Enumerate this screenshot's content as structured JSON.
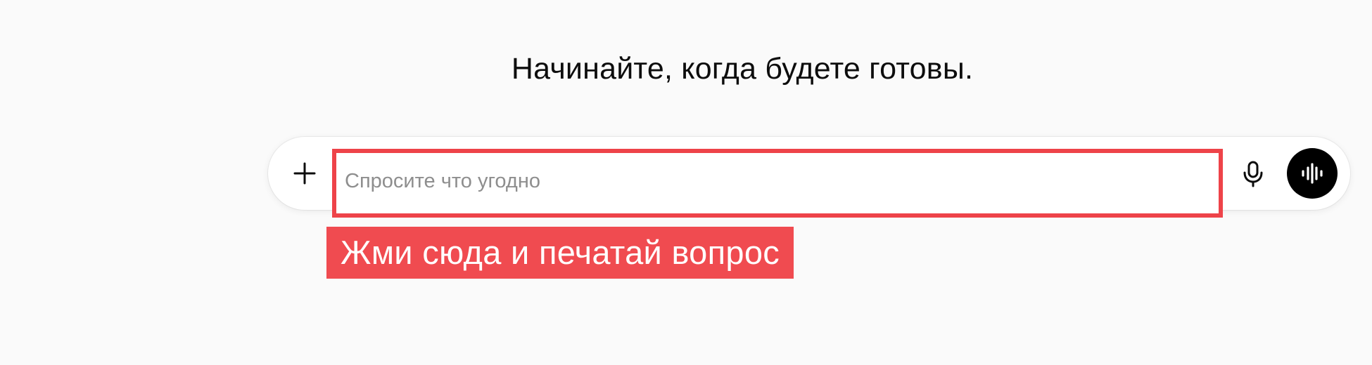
{
  "heading": "Начинайте, когда будете готовы.",
  "composer": {
    "placeholder": "Спросите что угодно",
    "value": "",
    "icons": {
      "add": "plus-icon",
      "dictate": "microphone-icon",
      "voice_mode": "soundwave-icon"
    }
  },
  "annotation": {
    "label": "Жми сюда и печатай вопрос",
    "highlight_color": "#ee4349",
    "label_background": "#f04b50"
  },
  "colors": {
    "background": "#fafafa",
    "voice_button": "#000000",
    "placeholder_text": "#8e8e8e"
  }
}
